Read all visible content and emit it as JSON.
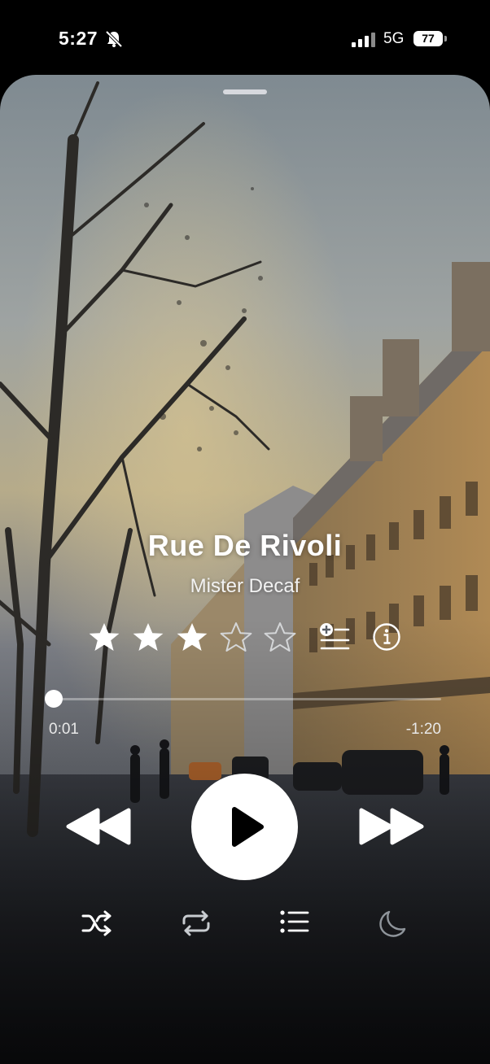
{
  "status_bar": {
    "time": "5:27",
    "network": "5G",
    "battery": "77",
    "icons": [
      "bell-slash-icon",
      "signal-bars-icon",
      "battery-icon"
    ]
  },
  "now_playing": {
    "title": "Rue De Rivoli",
    "artist": "Mister Decaf",
    "rating": {
      "value": 3,
      "max": 5
    },
    "progress": {
      "elapsed": "0:01",
      "remaining": "-1:20",
      "fraction": 0.012
    }
  },
  "controls": {
    "transport": [
      "rewind-icon",
      "play-icon",
      "fast-forward-icon"
    ],
    "bottom": [
      "shuffle-icon",
      "repeat-icon",
      "queue-list-icon",
      "sleep-timer-moon-icon"
    ]
  },
  "colors": {
    "icon_active": "#ffffff",
    "icon_dim": "#c8ccd0",
    "icon_faint": "#8f959b"
  }
}
